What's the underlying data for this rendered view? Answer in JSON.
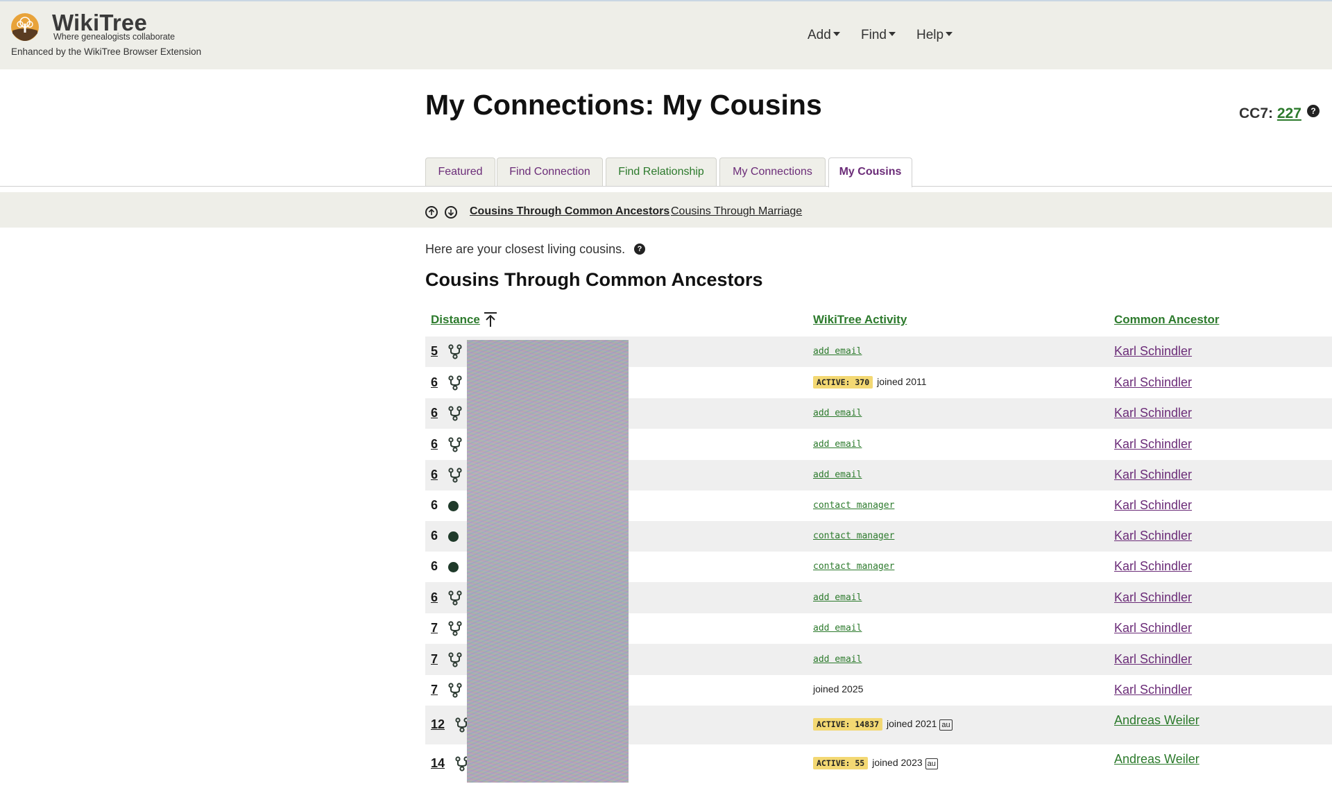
{
  "header": {
    "brand": "WikiTree",
    "tagline": "Where genealogists collaborate",
    "enhanced": "Enhanced by the WikiTree Browser Extension",
    "nav": [
      {
        "label": "Add"
      },
      {
        "label": "Find"
      },
      {
        "label": "Help"
      }
    ]
  },
  "page": {
    "title": "My Connections: My Cousins",
    "cc7_label": "CC7:",
    "cc7_value": "227",
    "help_glyph": "?"
  },
  "tabs": [
    {
      "label": "Featured"
    },
    {
      "label": "Find Connection"
    },
    {
      "label": "Find Relationship"
    },
    {
      "label": "My Connections"
    },
    {
      "label": "My Cousins",
      "active": true
    }
  ],
  "subnav": {
    "link1": "Cousins Through Common Ancestors",
    "link2": "Cousins Through Marriage"
  },
  "intro": "Here are your closest living cousins.",
  "section_title": "Cousins Through Common Ancestors",
  "table": {
    "headers": {
      "distance": "Distance",
      "activity": "WikiTree Activity",
      "ancestor": "Common Ancestor"
    },
    "rows": [
      {
        "distance": "5",
        "icon": "relationship-icon",
        "activity_type": "link",
        "activity": "add email",
        "ancestor": "Karl Schindler"
      },
      {
        "distance": "6",
        "icon": "relationship-icon",
        "activity_type": "status",
        "badge": "ACTIVE: 370",
        "joined": "joined 2011",
        "ancestor": "Karl Schindler"
      },
      {
        "distance": "6",
        "icon": "relationship-icon",
        "activity_type": "link",
        "activity": "add email",
        "ancestor": "Karl Schindler"
      },
      {
        "distance": "6",
        "icon": "relationship-icon",
        "activity_type": "link",
        "activity": "add email",
        "ancestor": "Karl Schindler"
      },
      {
        "distance": "6",
        "icon": "relationship-icon",
        "activity_type": "link",
        "activity": "add email",
        "ancestor": "Karl Schindler"
      },
      {
        "distance": "6",
        "icon": "dot-icon",
        "activity_type": "link",
        "activity": "contact manager",
        "ancestor": "Karl Schindler"
      },
      {
        "distance": "6",
        "icon": "dot-icon",
        "activity_type": "link",
        "activity": "contact manager",
        "ancestor": "Karl Schindler"
      },
      {
        "distance": "6",
        "icon": "dot-icon",
        "activity_type": "link",
        "activity": "contact manager",
        "ancestor": "Karl Schindler"
      },
      {
        "distance": "6",
        "icon": "relationship-icon",
        "activity_type": "link",
        "activity": "add email",
        "ancestor": "Karl Schindler"
      },
      {
        "distance": "7",
        "icon": "relationship-icon",
        "activity_type": "link",
        "activity": "add email",
        "ancestor": "Karl Schindler"
      },
      {
        "distance": "7",
        "icon": "relationship-icon",
        "activity_type": "link",
        "activity": "add email",
        "ancestor": "Karl Schindler"
      },
      {
        "distance": "7",
        "icon": "relationship-icon",
        "activity_type": "status",
        "joined": "joined 2025",
        "ancestor": "Karl Schindler"
      },
      {
        "distance": "12",
        "icon": "relationship-icon",
        "activity_type": "status",
        "badge": "ACTIVE: 14837",
        "joined": "joined 2021",
        "lang": "au",
        "ancestor": "Andreas Weiler"
      },
      {
        "distance": "14",
        "icon": "relationship-icon",
        "activity_type": "status",
        "badge": "ACTIVE: 55",
        "joined": "joined 2023",
        "lang": "au",
        "ancestor": "Andreas Weiler"
      }
    ]
  },
  "colors": {
    "header_bg": "#eeeee8",
    "link_green": "#2c7a2c",
    "link_purple": "#6b2c78",
    "badge_yellow": "#f3d873"
  }
}
